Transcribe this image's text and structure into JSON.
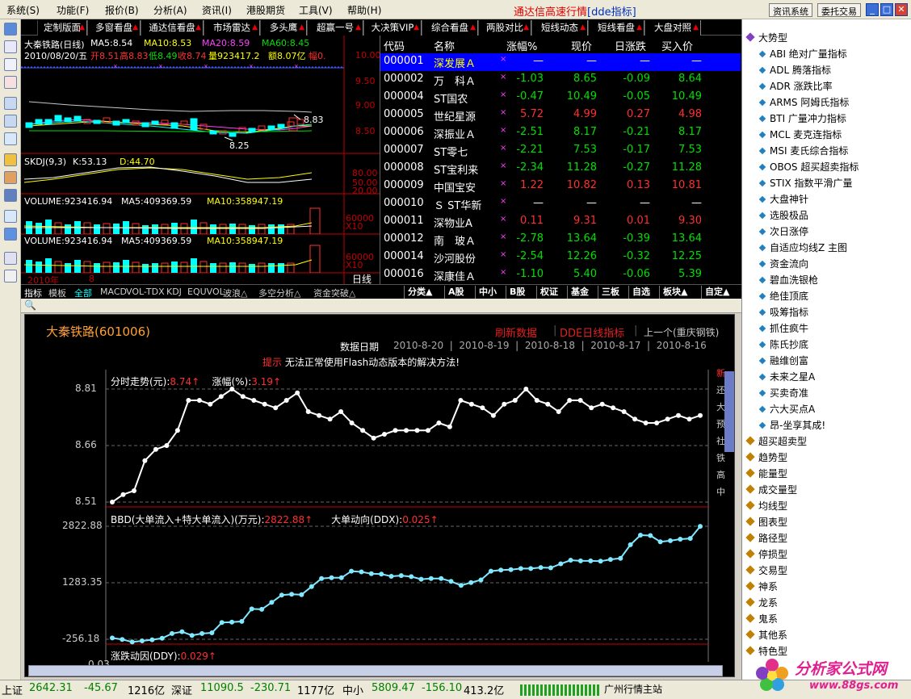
{
  "menu": [
    "系统(S)",
    "功能(F)",
    "报价(B)",
    "分析(A)",
    "资讯(I)",
    "港股期货",
    "工具(V)",
    "帮助(H)"
  ],
  "app_title": "通达信高速行情",
  "app_title_dde": "[dde指标]",
  "top_buttons": [
    "资讯系统",
    "委托交易"
  ],
  "window_buttons": [
    "_",
    "□",
    "✕"
  ],
  "tabs": [
    "定制版面",
    "多窗看盘",
    "通达信看盘",
    "市场雷达",
    "多头鹰",
    "超赢一号",
    "大决策VIP",
    "综合看盘",
    "两股对比",
    "短线动态",
    "短线看盘",
    "大盘对照"
  ],
  "kchart": {
    "title": "大秦铁路(日线)",
    "ma5": "MA5:8.54",
    "ma10": "MA10:8.53",
    "ma20": "MA20:8.59",
    "ma60": "MA60:8.45",
    "ohlc_date": "2010/08/20/五",
    "ohlc_open": "开8.51",
    "ohlc_high": "高8.83",
    "ohlc_low": "低8.49",
    "ohlc_close": "收8.74",
    "ohlc_vol": "量923417.2",
    "ohlc_amt": "额8.07亿",
    "ohlc_amp": "幅0.",
    "price_ticks": [
      "10.00",
      "9.50",
      "9.00",
      "8.50"
    ],
    "high_mark": "8.83",
    "low_mark": "8.25",
    "skdj_label": "SKDJ(9,3)",
    "skdj_k": "K:53.13",
    "skdj_d": "D:44.70",
    "skdj_ticks": [
      "80.00",
      "50.00",
      "20.00"
    ],
    "vol1_label": "VOLUME:923416.94",
    "vol1_ma5": "MA5:409369.59",
    "vol1_ma10": "MA10:358947.19",
    "vol_tick": "60000",
    "vol_x10": "X10",
    "vol2_label": "VOLUME:923416.94",
    "vol2_ma5": "MA5:409369.59",
    "vol2_ma10": "MA10:358947.19",
    "year_label": "2010年",
    "year_8": "8",
    "period": "日线"
  },
  "quote": {
    "headers": [
      "代码",
      "名称",
      "涨幅%",
      "现价",
      "日涨跌",
      "买入价"
    ],
    "rows": [
      {
        "code": "000001",
        "name": "深发展Ａ",
        "pct": "—",
        "price": "—",
        "chg": "—",
        "bid": "—",
        "color": "#ffffff",
        "sel": true
      },
      {
        "code": "000002",
        "name": "万　科Ａ",
        "pct": "-1.03",
        "price": "8.65",
        "chg": "-0.09",
        "bid": "8.64",
        "color": "#00e000"
      },
      {
        "code": "000004",
        "name": "ST国农",
        "pct": "-0.47",
        "price": "10.49",
        "chg": "-0.05",
        "bid": "10.49",
        "color": "#00e000"
      },
      {
        "code": "000005",
        "name": "世纪星源",
        "pct": "5.72",
        "price": "4.99",
        "chg": "0.27",
        "bid": "4.98",
        "color": "#ff3030"
      },
      {
        "code": "000006",
        "name": "深振业Ａ",
        "pct": "-2.51",
        "price": "8.17",
        "chg": "-0.21",
        "bid": "8.17",
        "color": "#00e000"
      },
      {
        "code": "000007",
        "name": "ST零七",
        "pct": "-2.21",
        "price": "7.53",
        "chg": "-0.17",
        "bid": "7.53",
        "color": "#00e000"
      },
      {
        "code": "000008",
        "name": "ST宝利来",
        "pct": "-2.34",
        "price": "11.28",
        "chg": "-0.27",
        "bid": "11.28",
        "color": "#00e000"
      },
      {
        "code": "000009",
        "name": "中国宝安",
        "pct": "1.22",
        "price": "10.82",
        "chg": "0.13",
        "bid": "10.81",
        "color": "#ff3030"
      },
      {
        "code": "000010",
        "name": "Ｓ ST华新",
        "pct": "—",
        "price": "—",
        "chg": "—",
        "bid": "—",
        "color": "#ffffff"
      },
      {
        "code": "000011",
        "name": "深物业A",
        "pct": "0.11",
        "price": "9.31",
        "chg": "0.01",
        "bid": "9.30",
        "color": "#ff3030"
      },
      {
        "code": "000012",
        "name": "南　玻Ａ",
        "pct": "-2.78",
        "price": "13.64",
        "chg": "-0.39",
        "bid": "13.64",
        "color": "#00e000"
      },
      {
        "code": "000014",
        "name": "沙河股份",
        "pct": "-2.54",
        "price": "12.26",
        "chg": "-0.32",
        "bid": "12.25",
        "color": "#00e000"
      },
      {
        "code": "000016",
        "name": "深康佳Ａ",
        "pct": "-1.10",
        "price": "5.40",
        "chg": "-0.06",
        "bid": "5.39",
        "color": "#00e000"
      }
    ]
  },
  "indicator_tabs": [
    "指标",
    "模板",
    "全部",
    "MACD",
    "VOL-TDX",
    "KDJ",
    "EQUVOL",
    "波浪△",
    "多空分析△",
    "资金突破△"
  ],
  "category_tabs": [
    "分类▲",
    "A股",
    "中小",
    "B股",
    "权证",
    "基金",
    "三板",
    "自选",
    "板块▲",
    "自定▲"
  ],
  "panel": {
    "stock": "大秦铁路(601006)",
    "refresh": "刷新数据",
    "dde_daily": "DDE日线指标",
    "prev": "上一个(重庆钢铁)",
    "date_label": "数据日期",
    "dates": [
      "2010-8-20",
      "2010-8-19",
      "2010-8-18",
      "2010-8-17",
      "2010-8-16"
    ],
    "tip_label": "提示",
    "tip_text": "无法正常使用Flash动态版本的解决方法!",
    "chart1_title": "分时走势(元):",
    "chart1_value": "8.74↑",
    "chart1_pct_label": "涨幅(%):",
    "chart1_pct_value": "3.19↑",
    "chart1_ticks": [
      "8.81",
      "8.66",
      "8.51"
    ],
    "chart2_title": "BBD(大单流入+特大单流入)(万元):",
    "chart2_value": "2822.88↑",
    "chart2_ddx_label": "大单动向(DDX):",
    "chart2_ddx_value": "0.025↑",
    "chart2_ticks": [
      "2822.88",
      "1283.35",
      "-256.18"
    ],
    "chart3_title": "涨跌动因(DDY):",
    "chart3_value": "0.029↑",
    "chart3_tick": "0.03",
    "side_chars": [
      "新",
      "还",
      "大",
      "预",
      "社",
      "铁",
      "高",
      "中"
    ]
  },
  "chart_data": [
    {
      "type": "line",
      "title": "分时走势(元):",
      "ylim": [
        8.51,
        8.81
      ],
      "values": [
        8.51,
        8.53,
        8.54,
        8.62,
        8.65,
        8.66,
        8.7,
        8.78,
        8.78,
        8.77,
        8.79,
        8.81,
        8.79,
        8.78,
        8.77,
        8.76,
        8.78,
        8.8,
        8.75,
        8.74,
        8.73,
        8.75,
        8.72,
        8.7,
        8.68,
        8.69,
        8.7,
        8.7,
        8.7,
        8.7,
        8.72,
        8.71,
        8.78,
        8.77,
        8.76,
        8.74,
        8.77,
        8.78,
        8.81,
        8.78,
        8.77,
        8.75,
        8.78,
        8.78,
        8.76,
        8.77,
        8.76,
        8.75,
        8.73,
        8.72,
        8.72,
        8.73,
        8.74,
        8.73,
        8.74
      ]
    },
    {
      "type": "line",
      "title": "BBD(大单流入+特大单流入)(万元):",
      "ylim": [
        -256.18,
        2822.88
      ],
      "values": [
        -220,
        -260,
        -330,
        -300,
        -270,
        -230,
        -100,
        -50,
        -150,
        -100,
        -80,
        200,
        210,
        230,
        570,
        560,
        750,
        950,
        970,
        960,
        1180,
        1400,
        1420,
        1420,
        1600,
        1580,
        1530,
        1520,
        1460,
        1480,
        1450,
        1380,
        1400,
        1400,
        1320,
        1210,
        1290,
        1360,
        1600,
        1630,
        1640,
        1670,
        1670,
        1700,
        1690,
        1800,
        1900,
        1880,
        1880,
        1870,
        1920,
        1950,
        2320,
        2580,
        2570,
        2400,
        2430,
        2470,
        2490,
        2820
      ]
    }
  ],
  "right_tree": [
    {
      "label": "大势型",
      "level": 1,
      "color": "#8040c0"
    },
    {
      "label": "ABI 绝对广量指标",
      "level": 2
    },
    {
      "label": "ADL 腾落指标",
      "level": 2
    },
    {
      "label": "ADR 涨跌比率",
      "level": 2
    },
    {
      "label": "ARMS 阿姆氏指标",
      "level": 2
    },
    {
      "label": "BTI 广量冲力指标",
      "level": 2
    },
    {
      "label": "MCL 麦克连指标",
      "level": 2
    },
    {
      "label": "MSI 麦氏综合指标",
      "level": 2
    },
    {
      "label": "OBOS 超买超卖指标",
      "level": 2
    },
    {
      "label": "STIX 指数平滑广量",
      "level": 2
    },
    {
      "label": "大盘神针",
      "level": 2
    },
    {
      "label": "选股极品",
      "level": 2
    },
    {
      "label": "次日涨停",
      "level": 2
    },
    {
      "label": "自适应均线Z 主图",
      "level": 2
    },
    {
      "label": "资金流向",
      "level": 2
    },
    {
      "label": "碧血洗银枪",
      "level": 2
    },
    {
      "label": "绝佳顶底",
      "level": 2
    },
    {
      "label": "吸筹指标",
      "level": 2
    },
    {
      "label": "抓住疯牛",
      "level": 2
    },
    {
      "label": "陈氏抄底",
      "level": 2
    },
    {
      "label": "融维创富",
      "level": 2
    },
    {
      "label": "未来之星A",
      "level": 2
    },
    {
      "label": "买卖奇准",
      "level": 2
    },
    {
      "label": "六大买点A",
      "level": 2
    },
    {
      "label": "昂-坐享其成!",
      "level": 2
    },
    {
      "label": "超买超卖型",
      "level": 1,
      "color": "#c08000"
    },
    {
      "label": "趋势型",
      "level": 1,
      "color": "#c08000"
    },
    {
      "label": "能量型",
      "level": 1,
      "color": "#c08000"
    },
    {
      "label": "成交量型",
      "level": 1,
      "color": "#c08000"
    },
    {
      "label": "均线型",
      "level": 1,
      "color": "#c08000"
    },
    {
      "label": "图表型",
      "level": 1,
      "color": "#c08000"
    },
    {
      "label": "路径型",
      "level": 1,
      "color": "#c08000"
    },
    {
      "label": "停损型",
      "level": 1,
      "color": "#c08000"
    },
    {
      "label": "交易型",
      "level": 1,
      "color": "#c08000"
    },
    {
      "label": "神系",
      "level": 1,
      "color": "#c08000"
    },
    {
      "label": "龙系",
      "level": 1,
      "color": "#c08000"
    },
    {
      "label": "鬼系",
      "level": 1,
      "color": "#c08000"
    },
    {
      "label": "其他系",
      "level": 1,
      "color": "#c08000"
    },
    {
      "label": "特色型",
      "level": 1,
      "color": "#c08000"
    }
  ],
  "status": {
    "sh_label": "上证",
    "sh_val": "2642.31",
    "sh_chg": "-45.67",
    "sh_amt": "1216亿",
    "sz_label": "深证",
    "sz_val": "11090.5",
    "sz_chg": "-230.71",
    "sz_amt": "1177亿",
    "zx_label": "中小",
    "zx_val": "5809.47",
    "zx_chg": "-156.10",
    "zx_amt": "413.2亿",
    "server": "广州行情主站"
  },
  "watermark": {
    "title": "分析家公式网",
    "url": "www.88gs.com"
  }
}
